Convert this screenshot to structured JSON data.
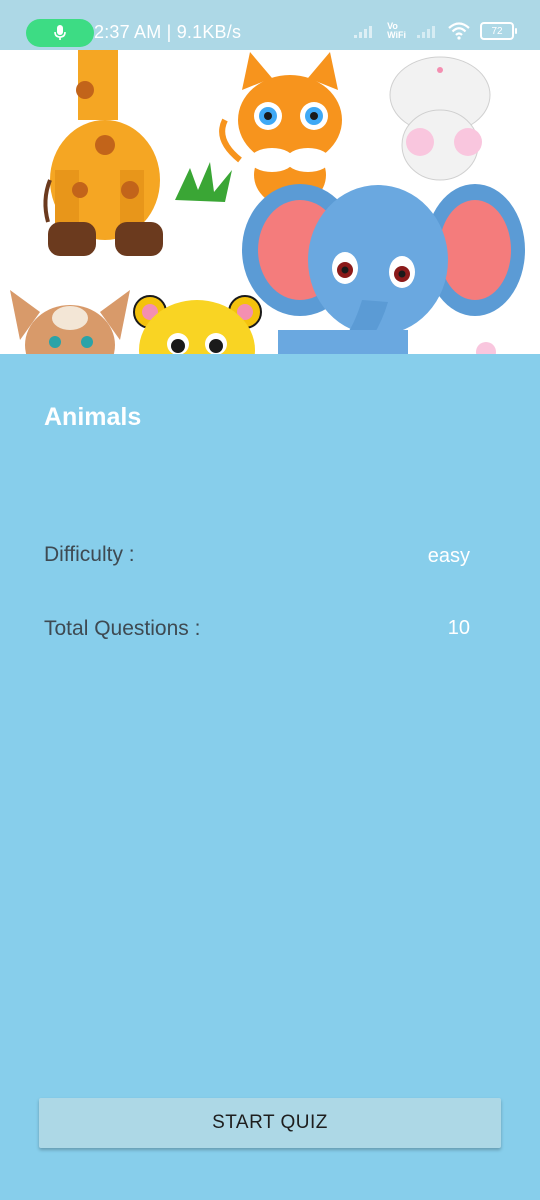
{
  "status_bar": {
    "time_speed": "2:37 AM | 9.1KB/s",
    "vowifi_line1": "Vo",
    "vowifi_line2": "WiFi",
    "battery_level": "72",
    "mic_color": "#3ddc84"
  },
  "quiz": {
    "category": "Animals",
    "difficulty_label": "Difficulty :",
    "difficulty_value": "easy",
    "questions_label": "Total Questions :",
    "questions_value": "10",
    "start_button": "START QUIZ"
  },
  "colors": {
    "background": "#87ceeb",
    "status_bar": "#add8e6",
    "button": "#add8e6"
  },
  "banner_icons": [
    "giraffe-icon",
    "kitten-icon",
    "bunny-icon",
    "grass-icon",
    "elephant-icon",
    "fawn-icon",
    "tiger-cub-icon"
  ]
}
